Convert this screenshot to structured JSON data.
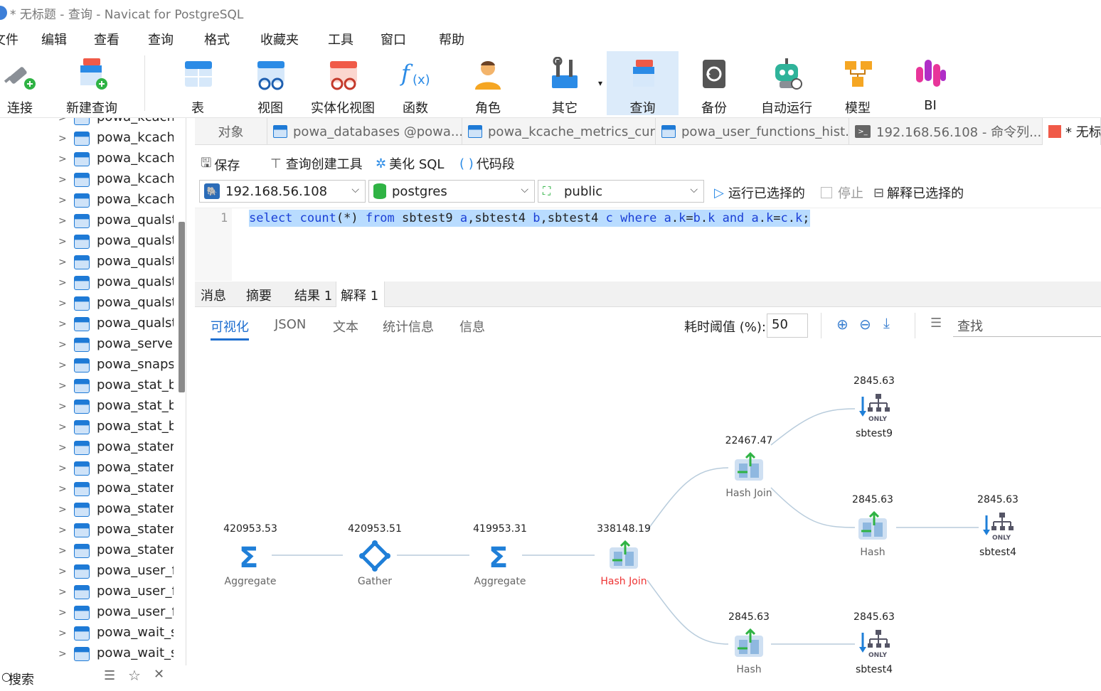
{
  "window": {
    "title": "* 无标题 - 查询 - Navicat for PostgreSQL"
  },
  "menu": [
    "文件",
    "编辑",
    "查看",
    "查询",
    "格式",
    "收藏夹",
    "工具",
    "窗口",
    "帮助"
  ],
  "toolbar": {
    "connect": "连接",
    "new_query": "新建查询",
    "table": "表",
    "view": "视图",
    "mat_view": "实体化视图",
    "function": "函数",
    "role": "角色",
    "other": "其它",
    "query": "查询",
    "backup": "备份",
    "automation": "自动运行",
    "model": "模型",
    "bi": "BI"
  },
  "sidebar": {
    "items": [
      "powa_kcache",
      "powa_kcache",
      "powa_kcache",
      "powa_kcache",
      "powa_kcache",
      "powa_qualst",
      "powa_qualst",
      "powa_qualst",
      "powa_qualst",
      "powa_qualst",
      "powa_qualst",
      "powa_server",
      "powa_snapsl",
      "powa_stat_b",
      "powa_stat_b",
      "powa_stat_b",
      "powa_staten",
      "powa_staten",
      "powa_staten",
      "powa_staten",
      "powa_staten",
      "powa_staten",
      "powa_user_f",
      "powa_user_f",
      "powa_user_f",
      "powa_wait_s",
      "powa_wait_s"
    ],
    "search_label": "搜索"
  },
  "tabs": {
    "objects": "对象",
    "t1": "powa_databases @powa....",
    "t2": "powa_kcache_metrics_cur...",
    "t3": "powa_user_functions_hist...",
    "t4": "192.168.56.108 - 命令列...",
    "t5": "* 无标"
  },
  "query_toolbar": {
    "save": "保存",
    "builder": "查询创建工具",
    "beautify": "美化 SQL",
    "snippet": "代码段"
  },
  "selectors": {
    "connection": "192.168.56.108",
    "database": "postgres",
    "schema": "public"
  },
  "run": {
    "run_selected": "运行已选择的",
    "stop": "停止",
    "explain_selected": "解释已选择的"
  },
  "editor": {
    "line_no": "1",
    "tokens": [
      {
        "t": "select",
        "k": 1
      },
      {
        "t": " ",
        "k": 0
      },
      {
        "t": "count",
        "k": 1
      },
      {
        "t": "(*) ",
        "k": 0
      },
      {
        "t": "from",
        "k": 1
      },
      {
        "t": " sbtest9 ",
        "k": 0
      },
      {
        "t": "a",
        "k": 1
      },
      {
        "t": ",sbtest4 ",
        "k": 0
      },
      {
        "t": "b",
        "k": 1
      },
      {
        "t": ",sbtest4 ",
        "k": 0
      },
      {
        "t": "c",
        "k": 1
      },
      {
        "t": " ",
        "k": 0
      },
      {
        "t": "where",
        "k": 1
      },
      {
        "t": " ",
        "k": 0
      },
      {
        "t": "a",
        "k": 1
      },
      {
        "t": ".",
        "k": 0
      },
      {
        "t": "k",
        "k": 1
      },
      {
        "t": "=",
        "k": 0
      },
      {
        "t": "b",
        "k": 1
      },
      {
        "t": ".",
        "k": 0
      },
      {
        "t": "k",
        "k": 1
      },
      {
        "t": " ",
        "k": 0
      },
      {
        "t": "and",
        "k": 1
      },
      {
        "t": " ",
        "k": 0
      },
      {
        "t": "a",
        "k": 1
      },
      {
        "t": ".",
        "k": 0
      },
      {
        "t": "k",
        "k": 1
      },
      {
        "t": "=",
        "k": 0
      },
      {
        "t": "c",
        "k": 1
      },
      {
        "t": ".",
        "k": 0
      },
      {
        "t": "k",
        "k": 1
      },
      {
        "t": ";",
        "k": 0
      }
    ]
  },
  "result_tabs": {
    "messages": "消息",
    "summary": "摘要",
    "result1": "结果 1",
    "explain1": "解释 1"
  },
  "viz_tabs": {
    "visual": "可视化",
    "json": "JSON",
    "text": "文本",
    "stats": "统计信息",
    "info": "信息"
  },
  "threshold": {
    "label": "耗时阈值 (%):",
    "value": "50"
  },
  "plan_search": {
    "placeholder": "查找"
  },
  "plan": {
    "agg1": {
      "cost": "420953.53",
      "label": "Aggregate"
    },
    "gather": {
      "cost": "420953.51",
      "label": "Gather"
    },
    "agg2": {
      "cost": "419953.31",
      "label": "Aggregate"
    },
    "hj_main": {
      "cost": "338148.19",
      "label": "Hash Join"
    },
    "hj_top": {
      "cost": "22467.47",
      "label": "Hash Join"
    },
    "scan9": {
      "cost": "2845.63",
      "label": "sbtest9"
    },
    "hash_mid": {
      "cost": "2845.63",
      "label": "Hash"
    },
    "scan4a": {
      "cost": "2845.63",
      "label": "sbtest4"
    },
    "hash_bot": {
      "cost": "2845.63",
      "label": "Hash"
    },
    "scan4b": {
      "cost": "2845.63",
      "label": "sbtest4"
    }
  },
  "colors": {
    "accent": "#1f6fd0",
    "hot_node": "#e33333",
    "selection": "#b9dcff"
  }
}
